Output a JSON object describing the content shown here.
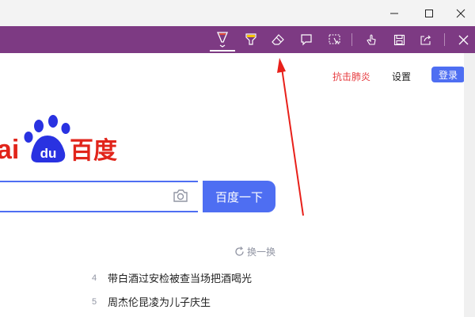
{
  "window": {
    "minimize_icon": "minimize-icon",
    "maximize_icon": "maximize-icon",
    "close_icon": "close-icon"
  },
  "ink_toolbar": {
    "background": "#7d3a83",
    "tools": [
      "ballpoint-pen-icon",
      "highlighter-icon",
      "eraser-icon",
      "add-note-icon",
      "clip-icon",
      "touch-writing-icon",
      "save-icon",
      "share-icon",
      "exit-icon"
    ],
    "highlighter_color": "#f5c400",
    "pen_color": "#e04b3a"
  },
  "header": {
    "link_1": "抗击肺炎",
    "link_2": "设置",
    "login": "登录",
    "link_1_color": "#e6393d",
    "login_bg": "#4e6ef2"
  },
  "logo": {
    "text_left": "ai",
    "paw_text": "du",
    "text_right": "百度",
    "red": "#e1251b",
    "blue": "#2932e1"
  },
  "search": {
    "value": "",
    "button": "百度一下"
  },
  "hot": {
    "refresh": "换一换",
    "items": [
      {
        "rank": "4",
        "text": "带白酒过安检被查当场把酒喝光"
      },
      {
        "rank": "5",
        "text": "周杰伦昆凌为儿子庆生"
      }
    ]
  },
  "annotation": {
    "arrow_color": "#e8201a"
  }
}
